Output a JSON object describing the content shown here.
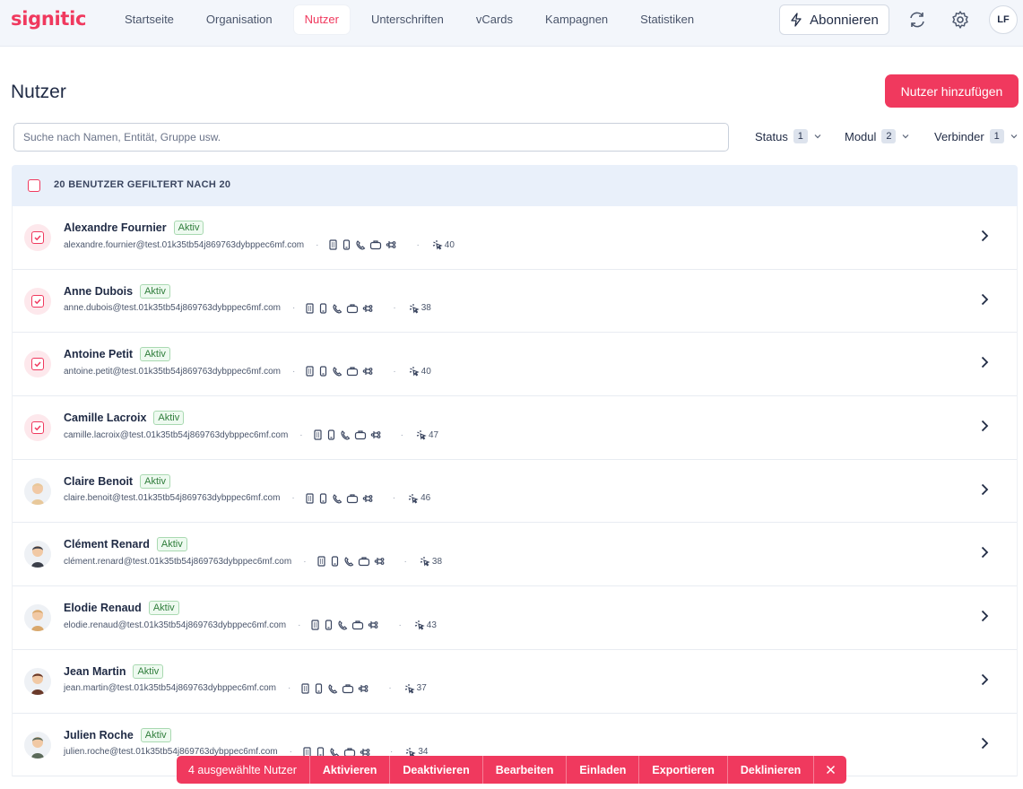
{
  "app": {
    "logo": "signitic"
  },
  "nav": {
    "items": [
      "Startseite",
      "Organisation",
      "Nutzer",
      "Unterschriften",
      "vCards",
      "Kampagnen",
      "Statistiken"
    ],
    "active": "Nutzer",
    "subscribe_label": "Abonnieren",
    "avatar_initials": "LF"
  },
  "page": {
    "title": "Nutzer",
    "add_button": "Nutzer hinzufügen",
    "search_placeholder": "Suche nach Namen, Entität, Gruppe usw."
  },
  "filters": [
    {
      "label": "Status",
      "count": "1"
    },
    {
      "label": "Modul",
      "count": "2"
    },
    {
      "label": "Verbinder",
      "count": "1"
    }
  ],
  "list": {
    "header": "20 BENUTZER GEFILTERT NACH 20",
    "users": [
      {
        "name": "Alexandre Fournier",
        "status": "Aktiv",
        "email": "alexandre.fournier@test.01k35tb54j869763dybppec6mf.com",
        "count": "40",
        "selected": true,
        "avatar_color": ""
      },
      {
        "name": "Anne Dubois",
        "status": "Aktiv",
        "email": "anne.dubois@test.01k35tb54j869763dybppec6mf.com",
        "count": "38",
        "selected": true,
        "avatar_color": ""
      },
      {
        "name": "Antoine Petit",
        "status": "Aktiv",
        "email": "antoine.petit@test.01k35tb54j869763dybppec6mf.com",
        "count": "40",
        "selected": true,
        "avatar_color": ""
      },
      {
        "name": "Camille Lacroix",
        "status": "Aktiv",
        "email": "camille.lacroix@test.01k35tb54j869763dybppec6mf.com",
        "count": "47",
        "selected": true,
        "avatar_color": ""
      },
      {
        "name": "Claire Benoit",
        "status": "Aktiv",
        "email": "claire.benoit@test.01k35tb54j869763dybppec6mf.com",
        "count": "46",
        "selected": false,
        "avatar_color": "#e8c89a"
      },
      {
        "name": "Clément Renard",
        "status": "Aktiv",
        "email": "clément.renard@test.01k35tb54j869763dybppec6mf.com",
        "count": "38",
        "selected": false,
        "avatar_color": "#3b3f4a"
      },
      {
        "name": "Elodie Renaud",
        "status": "Aktiv",
        "email": "elodie.renaud@test.01k35tb54j869763dybppec6mf.com",
        "count": "43",
        "selected": false,
        "avatar_color": "#d9a86c"
      },
      {
        "name": "Jean Martin",
        "status": "Aktiv",
        "email": "jean.martin@test.01k35tb54j869763dybppec6mf.com",
        "count": "37",
        "selected": false,
        "avatar_color": "#6a3a2a"
      },
      {
        "name": "Julien Roche",
        "status": "Aktiv",
        "email": "julien.roche@test.01k35tb54j869763dybppec6mf.com",
        "count": "34",
        "selected": false,
        "avatar_color": "#5b6a5a"
      }
    ]
  },
  "bulk_actions": {
    "selected_label": "4 ausgewählte Nutzer",
    "actions": [
      "Aktivieren",
      "Deaktivieren",
      "Bearbeiten",
      "Einladen",
      "Exportieren",
      "Deklinieren"
    ]
  },
  "colors": {
    "brand": "#f0395e",
    "status_green": "#2f7d3b"
  }
}
